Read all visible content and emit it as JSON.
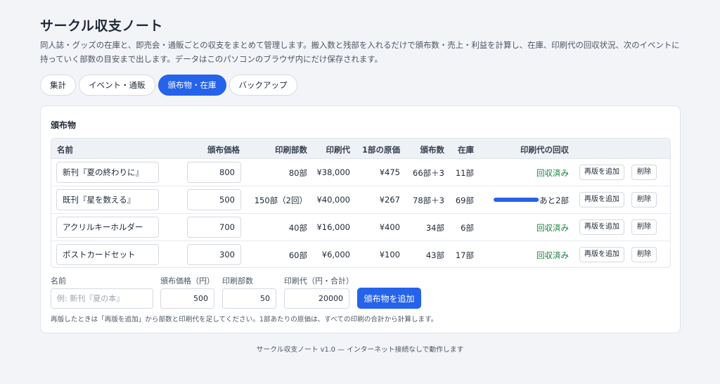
{
  "app": {
    "title": "サークル収支ノート",
    "description": "同人誌・グッズの在庫と、即売会・通販ごとの収支をまとめて管理します。搬入数と残部を入れるだけで頒布数・売上・利益を計算し、在庫、印刷代の回収状況、次のイベントに持っていく部数の目安まで出します。データはこのパソコンのブラウザ内にだけ保存されます。"
  },
  "tabs": [
    {
      "label": "集計",
      "active": false
    },
    {
      "label": "イベント・通販",
      "active": false
    },
    {
      "label": "頒布物・在庫",
      "active": true
    },
    {
      "label": "バックアップ",
      "active": false
    }
  ],
  "section": {
    "title": "頒布物"
  },
  "table": {
    "headers": {
      "name": "名前",
      "price": "頒布価格",
      "printed": "印刷部数",
      "print_cost": "印刷代",
      "unit_cost": "1部の原価",
      "distributed": "頒布数",
      "stock": "在庫",
      "recovery": "印刷代の回収"
    },
    "rows": [
      {
        "name": "新刊『夏の終わりに』",
        "price": "800",
        "printed": "80部",
        "print_cost": "¥38,000",
        "unit_cost": "¥475",
        "distributed": "66部＋3",
        "stock": "11部",
        "recovery_status": "回収済み",
        "recovered": true,
        "progress": 1.0,
        "reprint_label": "再版を追加",
        "delete_label": "削除"
      },
      {
        "name": "既刊『星を数える』",
        "price": "500",
        "printed": "150部（2回）",
        "print_cost": "¥40,000",
        "unit_cost": "¥267",
        "distributed": "78部＋3",
        "stock": "69部",
        "recovery_status": "あと2部",
        "recovered": false,
        "progress": 0.975,
        "reprint_label": "再版を追加",
        "delete_label": "削除"
      },
      {
        "name": "アクリルキーホルダー",
        "price": "700",
        "printed": "40部",
        "print_cost": "¥16,000",
        "unit_cost": "¥400",
        "distributed": "34部",
        "stock": "6部",
        "recovery_status": "回収済み",
        "recovered": true,
        "progress": 1.0,
        "reprint_label": "再版を追加",
        "delete_label": "削除"
      },
      {
        "name": "ポストカードセット",
        "price": "300",
        "printed": "60部",
        "print_cost": "¥6,000",
        "unit_cost": "¥100",
        "distributed": "43部",
        "stock": "17部",
        "recovery_status": "回収済み",
        "recovered": true,
        "progress": 1.0,
        "reprint_label": "再版を追加",
        "delete_label": "削除"
      }
    ]
  },
  "form": {
    "name_label": "名前",
    "name_placeholder": "例: 新刊『夏の本』",
    "price_label": "頒布価格（円）",
    "price_value": "500",
    "printed_label": "印刷部数",
    "printed_value": "50",
    "print_cost_label": "印刷代（円・合計）",
    "print_cost_value": "20000",
    "add_button": "頒布物を追加"
  },
  "note": "再版したときは「再版を追加」から部数と印刷代を足してください。1部あたりの原価は、すべての印刷の合計から計算します。",
  "footer": "サークル収支ノート v1.0 — インターネット接続なしで動作します",
  "colors": {
    "accent": "#2563eb",
    "recovered": "#15803d",
    "background": "#f3f4f8"
  }
}
